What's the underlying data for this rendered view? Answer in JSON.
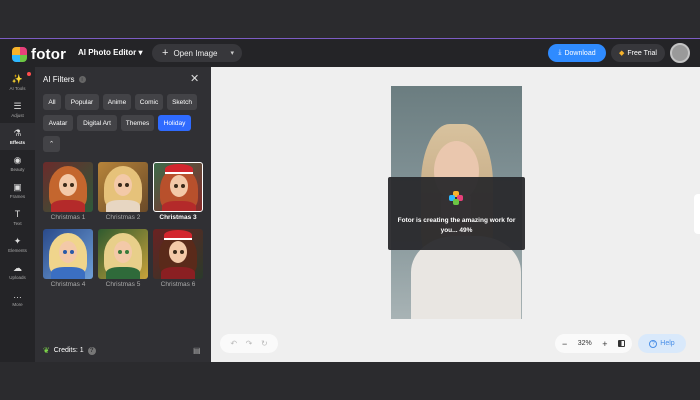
{
  "app": {
    "logo_text": "fotor",
    "editor_title": "AI Photo Editor ▾"
  },
  "toolbar": {
    "open_image": "Open Image",
    "open_caret": "▾",
    "download": "Download",
    "free_trial": "Free Trial"
  },
  "rail": {
    "items": [
      {
        "label": "AI Tools",
        "icon": "✨"
      },
      {
        "label": "Adjust",
        "icon": "☰"
      },
      {
        "label": "Effects",
        "icon": "⚗"
      },
      {
        "label": "Beauty",
        "icon": "◉"
      },
      {
        "label": "Frames",
        "icon": "▣"
      },
      {
        "label": "Text",
        "icon": "T"
      },
      {
        "label": "Elements",
        "icon": "✦"
      },
      {
        "label": "Uploads",
        "icon": "☁"
      },
      {
        "label": "More",
        "icon": "…"
      }
    ],
    "active_index": 2
  },
  "panel": {
    "title": "AI Filters",
    "close": "✕",
    "categories_row1": [
      "All",
      "Popular",
      "Anime",
      "Comic",
      "Sketch"
    ],
    "categories_row2": [
      "Avatar",
      "Digital Art",
      "Themes",
      "Holiday"
    ],
    "active_category": "Holiday",
    "collapse": "⌃",
    "filters": [
      {
        "label": "Christmas 1"
      },
      {
        "label": "Christmas 2"
      },
      {
        "label": "Christmas 3"
      },
      {
        "label": "Christmas 4"
      },
      {
        "label": "Christmas 5"
      },
      {
        "label": "Christmas 6"
      }
    ],
    "selected_filter": "Christmas 3",
    "credits": "Credits: 1",
    "help": "?"
  },
  "canvas": {
    "progress_message": "Fotor is creating the amazing work for you... 49%",
    "progress_percent": 49
  },
  "bottom": {
    "undo": "↶",
    "redo": "↷",
    "reset": "↻",
    "zoom_out": "−",
    "zoom_value": "32%",
    "zoom_in": "+",
    "help": "Help",
    "help_icon": "?"
  },
  "colors": {
    "accent": "#2f6bff",
    "download_blue": "#2f8bff",
    "panel_bg": "#303034",
    "topbar_bg": "#242427"
  }
}
